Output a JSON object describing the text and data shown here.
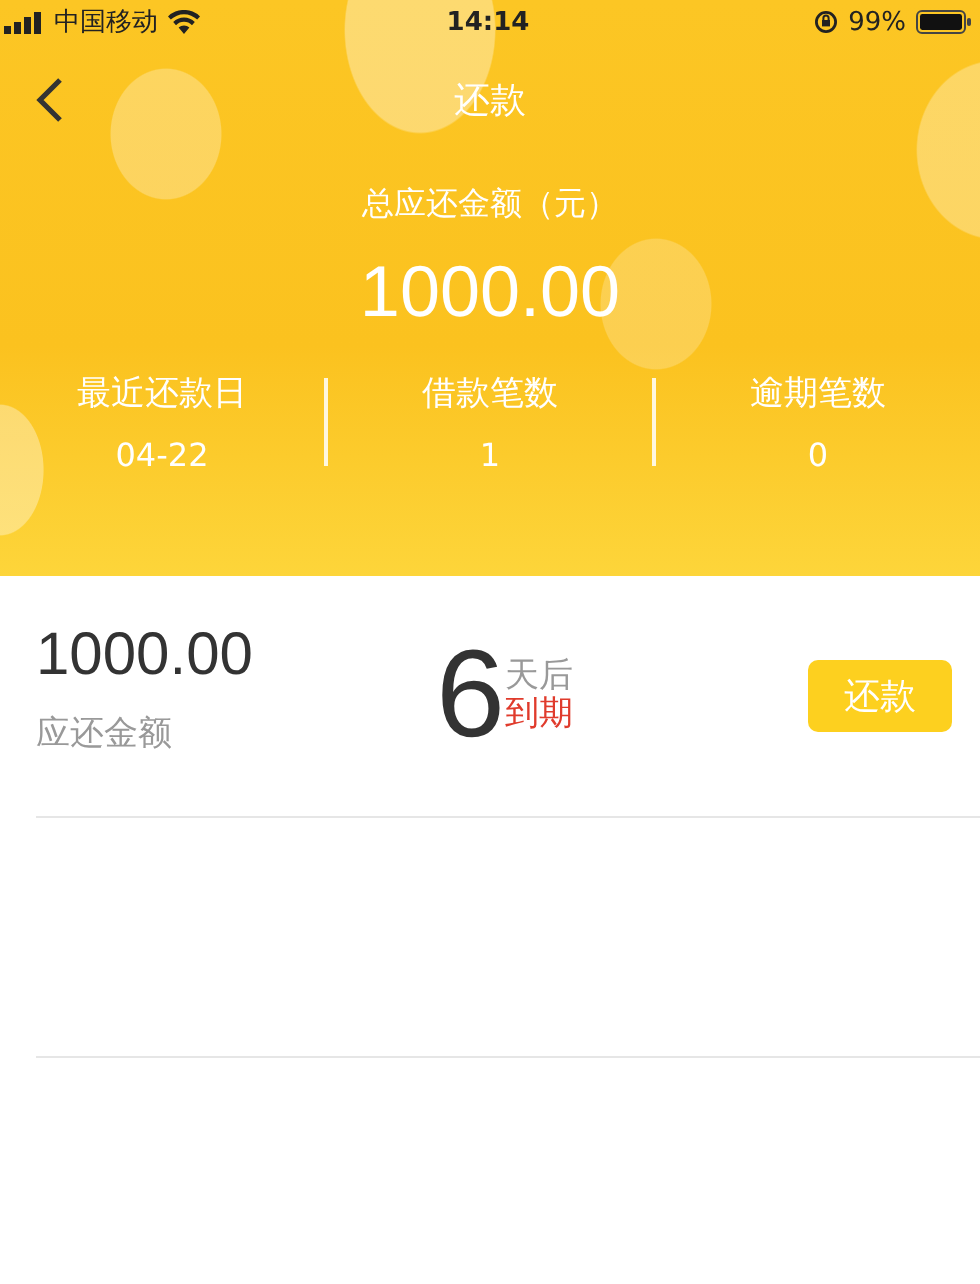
{
  "status_bar": {
    "carrier": "中国移动",
    "time": "14:14",
    "battery": "99%"
  },
  "nav": {
    "title": "还款"
  },
  "summary": {
    "label": "总应还金额（元）",
    "amount": "1000.00",
    "stats": [
      {
        "label": "最近还款日",
        "value": "04-22"
      },
      {
        "label": "借款笔数",
        "value": "1"
      },
      {
        "label": "逾期笔数",
        "value": "0"
      }
    ]
  },
  "loans": [
    {
      "amount": "1000.00",
      "amount_label": "应还金额",
      "days": "6",
      "days_unit": "天后",
      "due_text": "到期",
      "button": "还款"
    }
  ]
}
